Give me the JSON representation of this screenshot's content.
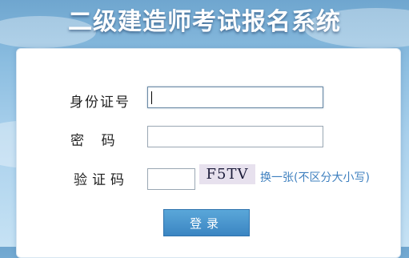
{
  "header": {
    "title": "二级建造师考试报名系统"
  },
  "form": {
    "id_label": "身份证号",
    "id_value": "",
    "password_label": "密    码",
    "password_value": "",
    "captcha_label": "验证码",
    "captcha_value": "",
    "captcha_image_text": "F5TV",
    "refresh_text": "换一张(不区分大小写)",
    "submit_label": "登录"
  },
  "colors": {
    "accent": "#3b85c2",
    "link": "#3f80bf",
    "captcha_bg": "#e7e1ee"
  }
}
